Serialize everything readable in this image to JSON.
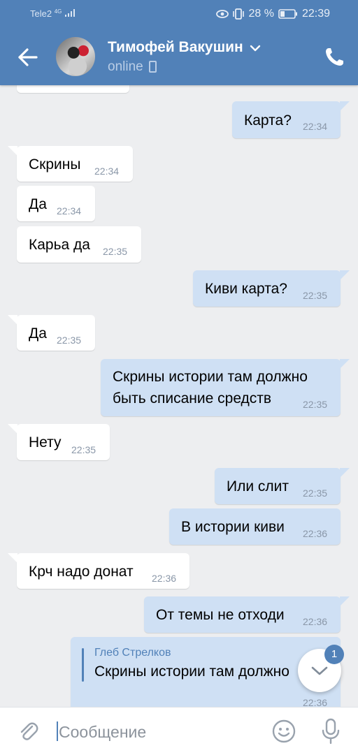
{
  "status_bar": {
    "carrier": "Tele2",
    "network": "4G",
    "battery": "28 %",
    "time": "22:39"
  },
  "header": {
    "contact_name": "Тимофей Вакушин",
    "status": "online"
  },
  "messages": [
    {
      "direction": "out",
      "text": "Карта?",
      "time": "22:34"
    },
    {
      "direction": "in",
      "text": "Скрины",
      "time": "22:34"
    },
    {
      "direction": "in",
      "text": "Да",
      "time": "22:34"
    },
    {
      "direction": "in",
      "text": "Карьа да",
      "time": "22:35"
    },
    {
      "direction": "out",
      "text": "Киви карта?",
      "time": "22:35"
    },
    {
      "direction": "in",
      "text": "Да",
      "time": "22:35"
    },
    {
      "direction": "out",
      "line1": "Скрины истории там должно",
      "line2": "быть списание средств",
      "time": "22:35"
    },
    {
      "direction": "in",
      "text": "Нету",
      "time": "22:35"
    },
    {
      "direction": "out",
      "text": "Или слит",
      "time": "22:35"
    },
    {
      "direction": "out",
      "text": "В истории киви",
      "time": "22:36"
    },
    {
      "direction": "in",
      "text": "Крч надо донат",
      "time": "22:36"
    },
    {
      "direction": "out",
      "text": "От темы не отходи",
      "time": "22:36"
    },
    {
      "direction": "out",
      "reply_author": "Глеб Стрелков",
      "reply_text": "Скрины истории там должно",
      "time": "22:36"
    }
  ],
  "scroll_down": {
    "badge": "1"
  },
  "composer": {
    "placeholder": "Сообщение"
  },
  "colors": {
    "header_bg": "#5181b8",
    "chat_bg": "#edeef0",
    "outgoing_bubble": "#cfe0f4",
    "incoming_bubble": "#ffffff",
    "accent": "#5181b8"
  },
  "icons": [
    "back-arrow-icon",
    "chevron-down-icon",
    "phone-icon",
    "paperclip-icon",
    "smile-icon",
    "microphone-icon",
    "eye-icon",
    "vibrate-icon",
    "battery-icon",
    "signal-icon"
  ]
}
